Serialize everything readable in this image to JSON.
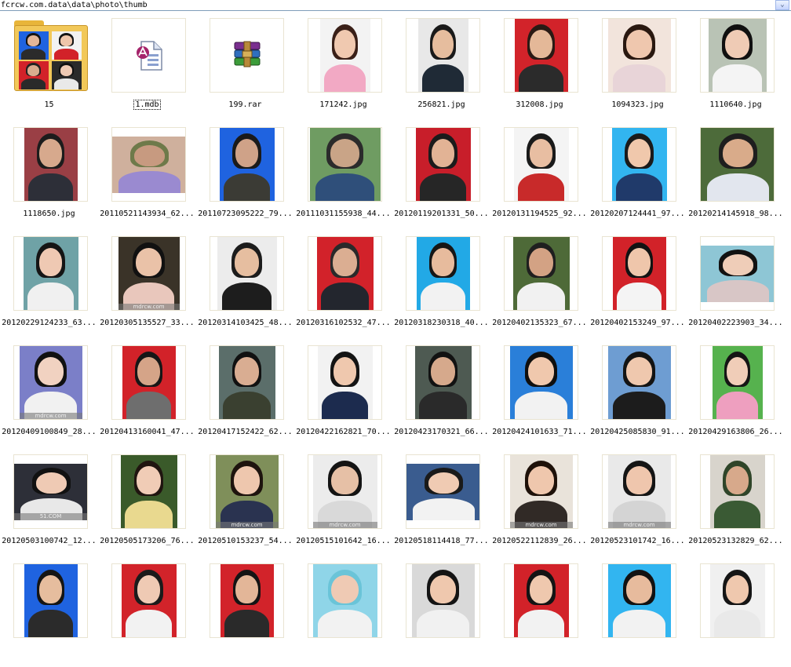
{
  "address_bar": {
    "path": "fcrcw.com.data\\data\\photo\\thumb",
    "dropdown_glyph": "⌄"
  },
  "items": [
    {
      "name": "15",
      "kind": "folder"
    },
    {
      "name": "1.mdb",
      "kind": "mdb",
      "selected": true
    },
    {
      "name": "199.rar",
      "kind": "rar"
    },
    {
      "name": "171242.jpg",
      "kind": "photo",
      "bg": "#f3f3f3",
      "skin": "#f0c9b0",
      "hair": "#3a2018",
      "shirt": "#f2a9c4",
      "w": 64,
      "h": 95
    },
    {
      "name": "256821.jpg",
      "kind": "photo",
      "bg": "#e8e8e8",
      "skin": "#e6bd9e",
      "hair": "#1a1a1a",
      "shirt": "#1f2a36",
      "w": 64,
      "h": 95
    },
    {
      "name": "312008.jpg",
      "kind": "photo",
      "bg": "#d2232a",
      "skin": "#e4b898",
      "hair": "#2a1a14",
      "shirt": "#2b2b2b",
      "w": 68,
      "h": 95
    },
    {
      "name": "1094323.jpg",
      "kind": "photo",
      "bg": "#f2e4dc",
      "skin": "#efc7ae",
      "hair": "#2a1810",
      "shirt": "#e8d4d8",
      "w": 80,
      "h": 95
    },
    {
      "name": "1110640.jpg",
      "kind": "photo",
      "bg": "#b9c3b5",
      "skin": "#efcbb5",
      "hair": "#101010",
      "shirt": "#f4f4f4",
      "w": 74,
      "h": 95
    },
    {
      "name": "1118650.jpg",
      "kind": "photo",
      "bg": "#9a3f45",
      "skin": "#d7a98d",
      "hair": "#1c1c1c",
      "shirt": "#2d2f38",
      "w": 68,
      "h": 95
    },
    {
      "name": "20110521143934_62...",
      "kind": "photo",
      "bg": "#cfb09d",
      "skin": "#c79a80",
      "hair": "#6e7a4a",
      "shirt": "#9a8ad0",
      "w": 95,
      "h": 72
    },
    {
      "name": "20110723095222_79...",
      "kind": "photo",
      "bg": "#1f63e0",
      "skin": "#cfa288",
      "hair": "#1a1a1a",
      "shirt": "#3b3b35",
      "w": 70,
      "h": 95
    },
    {
      "name": "20111031155938_44...",
      "kind": "photo",
      "bg": "#6f9c62",
      "skin": "#c9a487",
      "hair": "#2b2b2b",
      "shirt": "#2f4f7a",
      "w": 90,
      "h": 95
    },
    {
      "name": "20120119201331_50...",
      "kind": "photo",
      "bg": "#c81e2a",
      "skin": "#e2b395",
      "hair": "#1b1b1b",
      "shirt": "#262626",
      "w": 70,
      "h": 95
    },
    {
      "name": "20120131194525_92...",
      "kind": "photo",
      "bg": "#f4f4f4",
      "skin": "#e8bea2",
      "hair": "#1a1a1a",
      "shirt": "#c82a2a",
      "w": 70,
      "h": 95
    },
    {
      "name": "20120207124441_97...",
      "kind": "photo",
      "bg": "#32b5f0",
      "skin": "#f0c8ac",
      "hair": "#1a1a1a",
      "shirt": "#203a6a",
      "w": 70,
      "h": 95
    },
    {
      "name": "20120214145918_98...",
      "kind": "photo",
      "bg": "#4d6b3a",
      "skin": "#d9ab8a",
      "hair": "#1e1e1e",
      "shirt": "#e2e6ee",
      "w": 95,
      "h": 95
    },
    {
      "name": "20120229124233_63...",
      "kind": "photo",
      "bg": "#6fa2a6",
      "skin": "#efc9b3",
      "hair": "#151515",
      "shirt": "#f0f0f0",
      "w": 70,
      "h": 95
    },
    {
      "name": "20120305135527_33...",
      "kind": "photo",
      "bg": "#3a3328",
      "skin": "#eac2a8",
      "hair": "#111",
      "shirt": "#e9c7bc",
      "w": 78,
      "h": 95,
      "wm": "mdrcw.com"
    },
    {
      "name": "20120314103425_48...",
      "kind": "photo",
      "bg": "#ececec",
      "skin": "#e6bea0",
      "hair": "#1c1c1c",
      "shirt": "#1d1d1d",
      "w": 76,
      "h": 95
    },
    {
      "name": "20120316102532_47...",
      "kind": "photo",
      "bg": "#d2222a",
      "skin": "#dbae92",
      "hair": "#2a2a2a",
      "shirt": "#23262e",
      "w": 72,
      "h": 95
    },
    {
      "name": "20120318230318_40...",
      "kind": "photo",
      "bg": "#22a9e6",
      "skin": "#e7bb9d",
      "hair": "#161616",
      "shirt": "#f2f2f2",
      "w": 68,
      "h": 95
    },
    {
      "name": "20120402135323_67...",
      "kind": "photo",
      "bg": "#4e6a38",
      "skin": "#d3a284",
      "hair": "#1f1f1f",
      "shirt": "#f1f1f1",
      "w": 72,
      "h": 95
    },
    {
      "name": "20120402153249_97...",
      "kind": "photo",
      "bg": "#d22229",
      "skin": "#efc6ab",
      "hair": "#121212",
      "shirt": "#f4f4f4",
      "w": 68,
      "h": 95
    },
    {
      "name": "20120402223903_34...",
      "kind": "photo",
      "bg": "#8ec6d5",
      "skin": "#efcdb8",
      "hair": "#121212",
      "shirt": "#d8c6c6",
      "w": 95,
      "h": 72
    },
    {
      "name": "20120409100849_28...",
      "kind": "photo",
      "bg": "#7b7fc8",
      "skin": "#f1d2c1",
      "hair": "#111",
      "shirt": "#f1f1f1",
      "w": 80,
      "h": 95,
      "wm": "mdrcw.com"
    },
    {
      "name": "20120413160041_47...",
      "kind": "photo",
      "bg": "#d22229",
      "skin": "#d5a488",
      "hair": "#161616",
      "shirt": "#6e6e6e",
      "w": 68,
      "h": 95
    },
    {
      "name": "20120417152422_62...",
      "kind": "photo",
      "bg": "#5b6e6a",
      "skin": "#d9ad92",
      "hair": "#111",
      "shirt": "#3a4030",
      "w": 72,
      "h": 95
    },
    {
      "name": "20120422162821_70...",
      "kind": "photo",
      "bg": "#f2f2f2",
      "skin": "#efc8ae",
      "hair": "#141414",
      "shirt": "#1c2b4e",
      "w": 70,
      "h": 95
    },
    {
      "name": "20120423170321_66...",
      "kind": "photo",
      "bg": "#4e5a52",
      "skin": "#d6a98c",
      "hair": "#121212",
      "shirt": "#2a2a2a",
      "w": 72,
      "h": 95
    },
    {
      "name": "20120424101633_71...",
      "kind": "photo",
      "bg": "#2a7fd9",
      "skin": "#f0c8ad",
      "hair": "#0f0f0f",
      "shirt": "#f2f2f2",
      "w": 80,
      "h": 95
    },
    {
      "name": "20120425085830_91...",
      "kind": "photo",
      "bg": "#6e9dd2",
      "skin": "#efc8ae",
      "hair": "#141414",
      "shirt": "#1c1c1c",
      "w": 80,
      "h": 95
    },
    {
      "name": "20120429163806_26...",
      "kind": "photo",
      "bg": "#56b24e",
      "skin": "#f0cdb8",
      "hair": "#151515",
      "shirt": "#ee9fbf",
      "w": 64,
      "h": 95
    },
    {
      "name": "20120503100742_12...",
      "kind": "photo",
      "bg": "#2d2f38",
      "skin": "#efcab4",
      "hair": "#111",
      "shirt": "#e8e8e8",
      "w": 95,
      "h": 72,
      "wm": "51.COM"
    },
    {
      "name": "20120505173206_76...",
      "kind": "photo",
      "bg": "#3a5a2a",
      "skin": "#f0ccb6",
      "hair": "#201510",
      "shirt": "#e9d98f",
      "w": 72,
      "h": 95
    },
    {
      "name": "20120510153237_54...",
      "kind": "photo",
      "bg": "#7f8f5a",
      "skin": "#eec7ae",
      "hair": "#1e140e",
      "shirt": "#2a3350",
      "w": 80,
      "h": 95,
      "wm": "mdrcw.com"
    },
    {
      "name": "20120515101642_16...",
      "kind": "photo",
      "bg": "#ececec",
      "skin": "#e6c0a6",
      "hair": "#141414",
      "shirt": "#d9d9d9",
      "w": 82,
      "h": 95,
      "wm": "mdrcw.com"
    },
    {
      "name": "20120518114418_77...",
      "kind": "photo",
      "bg": "#3a5c8f",
      "skin": "#f0cbb3",
      "hair": "#1a1a1a",
      "shirt": "#f2f2f2",
      "w": 95,
      "h": 72
    },
    {
      "name": "20120522112839_26...",
      "kind": "photo",
      "bg": "#e9e3da",
      "skin": "#efc7ad",
      "hair": "#1e1109",
      "shirt": "#312a26",
      "w": 80,
      "h": 95,
      "wm": "mdrcw.com"
    },
    {
      "name": "20120523101742_16...",
      "kind": "photo",
      "bg": "#e9e9e9",
      "skin": "#efc6ad",
      "hair": "#151515",
      "shirt": "#d4d4d4",
      "w": 80,
      "h": 95,
      "wm": "mdrcw.com"
    },
    {
      "name": "20120523132829_62...",
      "kind": "photo",
      "bg": "#d8d4cc",
      "skin": "#d7a98b",
      "hair": "#2f4529",
      "shirt": "#3a5a34",
      "w": 70,
      "h": 95
    },
    {
      "name": "",
      "kind": "photo",
      "bg": "#1f63e0",
      "skin": "#e6bd9e",
      "hair": "#151515",
      "shirt": "#2b2b2b",
      "w": 68,
      "h": 95
    },
    {
      "name": "",
      "kind": "photo",
      "bg": "#d2232a",
      "skin": "#efcab4",
      "hair": "#1b1b1b",
      "shirt": "#f2f2f2",
      "w": 70,
      "h": 95
    },
    {
      "name": "",
      "kind": "photo",
      "bg": "#d2232a",
      "skin": "#e3b698",
      "hair": "#141414",
      "shirt": "#2a2a2a",
      "w": 68,
      "h": 95
    },
    {
      "name": "",
      "kind": "photo",
      "bg": "#8fd5e8",
      "skin": "#efcab4",
      "hair": "#6ac4d8",
      "shirt": "#f2f2f2",
      "w": 82,
      "h": 95
    },
    {
      "name": "",
      "kind": "photo",
      "bg": "#d9d9d9",
      "skin": "#efc8ae",
      "hair": "#141414",
      "shirt": "#f1f1f1",
      "w": 80,
      "h": 95
    },
    {
      "name": "",
      "kind": "photo",
      "bg": "#d22229",
      "skin": "#efc8ae",
      "hair": "#141414",
      "shirt": "#f2f2f2",
      "w": 70,
      "h": 95
    },
    {
      "name": "",
      "kind": "photo",
      "bg": "#32b5f0",
      "skin": "#e7bb9d",
      "hair": "#121212",
      "shirt": "#f2f2f2",
      "w": 80,
      "h": 95
    },
    {
      "name": "",
      "kind": "photo",
      "bg": "#f0f0f0",
      "skin": "#efc8ae",
      "hair": "#151515",
      "shirt": "#e9e9e9",
      "w": 70,
      "h": 95
    }
  ],
  "folder_thumbs": [
    {
      "bg": "#1f63e0",
      "skin": "#e3b698",
      "hair": "#141414",
      "shirt": "#2b2b2b"
    },
    {
      "bg": "#f2f2f2",
      "skin": "#efc6ab",
      "hair": "#141414",
      "shirt": "#d22229"
    },
    {
      "bg": "#d22229",
      "skin": "#d9ab8e",
      "hair": "#222",
      "shirt": "#2a2a2a"
    },
    {
      "bg": "#2a2a2a",
      "skin": "#efcab4",
      "hair": "#111",
      "shirt": "#e9e9e9"
    }
  ]
}
